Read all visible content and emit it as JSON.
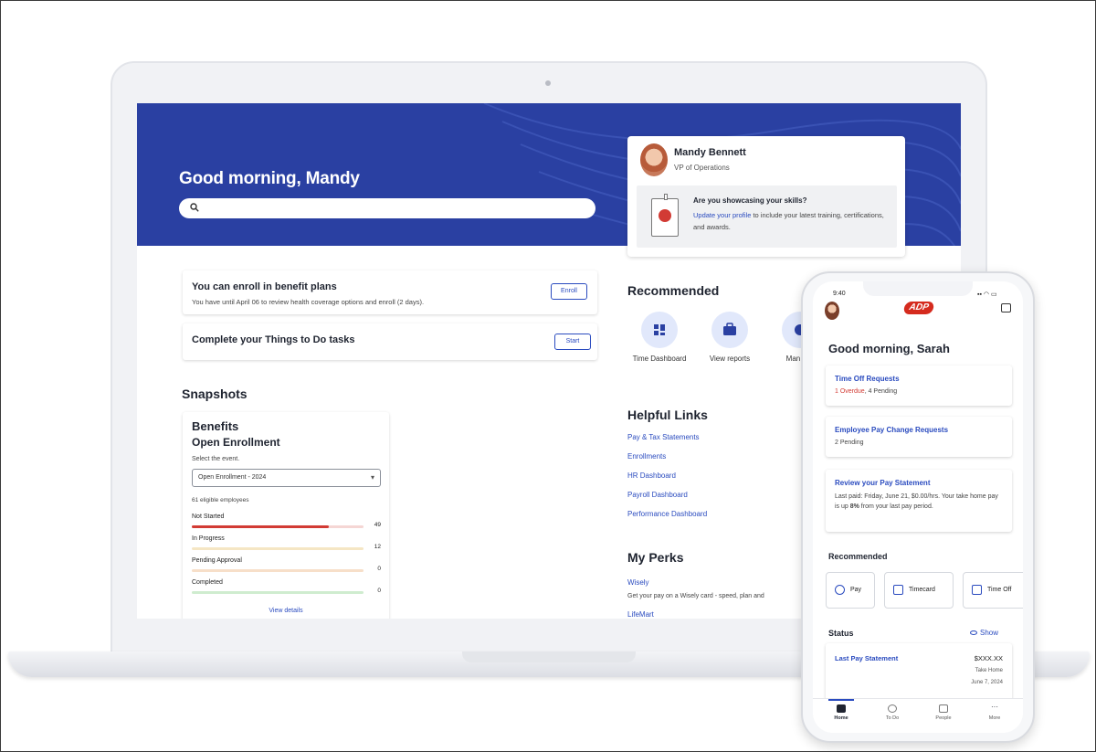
{
  "laptop": {
    "greeting": "Good morning, Mandy",
    "profile": {
      "name": "Mandy Bennett",
      "role": "VP of Operations",
      "promo_title": "Are you showcasing your skills?",
      "promo_link": "Update your profile",
      "promo_text": " to include your latest training, certifications, and awards."
    },
    "tasks": [
      {
        "title": "You can enroll in benefit plans",
        "subtitle": "You have until April 06 to review health coverage options and enroll (2 days).",
        "button": "Enroll"
      },
      {
        "title": "Complete your Things to Do tasks",
        "subtitle": "",
        "button": "Start"
      }
    ],
    "snapshots": {
      "heading": "Snapshots",
      "title": "Benefits",
      "subtitle": "Open Enrollment",
      "select_label": "Select the event.",
      "select_value": "Open Enrollment - 2024",
      "eligible": "61 eligible employees",
      "statuses": [
        {
          "label": "Not Started",
          "count": "49",
          "fraction": 0.8,
          "color": "#d23b34",
          "track": "#f5d6d4"
        },
        {
          "label": "In Progress",
          "count": "12",
          "fraction": 0.0,
          "color": "#e8b23a",
          "track": "#f5e6c4"
        },
        {
          "label": "Pending Approval",
          "count": "0",
          "fraction": 0.0,
          "color": "#e8b23a",
          "track": "#f7dfc9"
        },
        {
          "label": "Completed",
          "count": "0",
          "fraction": 0.0,
          "color": "#5cb85c",
          "track": "#cfeccf"
        }
      ],
      "view_details": "View details"
    },
    "recommended": {
      "heading": "Recommended",
      "items": [
        {
          "label": "Time Dashboard",
          "icon": "dashboard-icon"
        },
        {
          "label": "View reports",
          "icon": "briefcase-icon"
        },
        {
          "label": "Man pay",
          "icon": "currency-icon"
        }
      ]
    },
    "helpful_links": {
      "heading": "Helpful Links",
      "links": [
        "Pay & Tax Statements",
        "Enrollments",
        "HR Dashboard",
        "Payroll Dashboard",
        "Performance Dashboard"
      ]
    },
    "perks": {
      "heading": "My Perks",
      "items": [
        {
          "name": "Wisely",
          "desc": "Get your pay on a Wisely card - speed, plan and"
        },
        {
          "name": "LifeMart",
          "desc": ""
        }
      ]
    }
  },
  "phone": {
    "time": "9:40",
    "status_icons": "▪▪ ◠ ▭",
    "logo": "ADP",
    "greeting": "Good morning, Sarah",
    "cards": [
      {
        "title": "Time Off Requests",
        "overdue": "1 Overdue",
        "rest": ", 4 Pending"
      },
      {
        "title": "Employee Pay Change Requests",
        "sub": "2 Pending"
      },
      {
        "title": "Review your Pay Statement",
        "body_pre": "Last paid: Friday, June 21, $0.00/hrs. Your take home pay is up ",
        "body_bold": "8%",
        "body_post": " from your last pay period."
      }
    ],
    "recommended_heading": "Recommended",
    "chips": [
      "Pay",
      "Timecard",
      "Time Off"
    ],
    "status_heading": "Status",
    "show_label": "Show",
    "last_pay": {
      "title": "Last Pay Statement",
      "amount": "$XXX.XX",
      "note": "Take Home",
      "date": "June 7, 2024"
    },
    "tabs": [
      "Home",
      "To Do",
      "People",
      "More"
    ]
  },
  "colors": {
    "brand_blue": "#2a40a2",
    "link_blue": "#2a4bbf",
    "alert_red": "#d23b34"
  }
}
